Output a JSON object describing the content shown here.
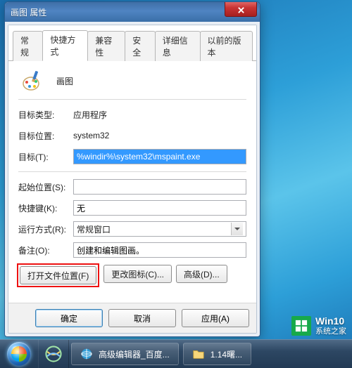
{
  "window": {
    "title": "画图 属性",
    "tabs": [
      "常规",
      "快捷方式",
      "兼容性",
      "安全",
      "详细信息",
      "以前的版本"
    ],
    "active_tab": 1,
    "app_name": "画图",
    "fields": {
      "target_type": {
        "label": "目标类型:",
        "value": "应用程序"
      },
      "target_loc": {
        "label": "目标位置:",
        "value": "system32"
      },
      "target": {
        "label": "目标(T):",
        "value": "%windir%\\system32\\mspaint.exe"
      },
      "start_in": {
        "label": "起始位置(S):",
        "value": ""
      },
      "shortcut_key": {
        "label": "快捷键(K):",
        "value": "无"
      },
      "run": {
        "label": "运行方式(R):",
        "value": "常规窗口"
      },
      "comment": {
        "label": "备注(O):",
        "value": "创建和编辑图画。"
      }
    },
    "buttons": {
      "open_loc": "打开文件位置(F)",
      "change_icon": "更改图标(C)...",
      "advanced": "高级(D)...",
      "ok": "确定",
      "cancel": "取消",
      "apply": "应用(A)"
    }
  },
  "taskbar": {
    "items": [
      {
        "label": "高级编辑器_百度..."
      },
      {
        "label": "1.14曙..."
      }
    ]
  },
  "watermark": {
    "line1": "Win10",
    "line2": "系统之家"
  }
}
